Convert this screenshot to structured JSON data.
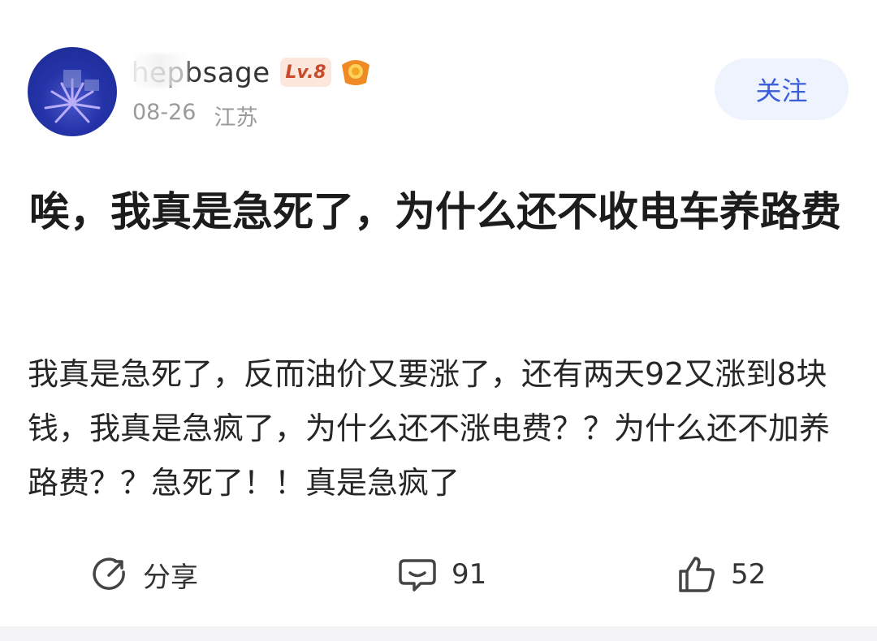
{
  "author": {
    "name": "hepbsage",
    "level_badge": "Lv.8",
    "post_date": "08-26",
    "location": "江苏",
    "follow_label": "关注"
  },
  "post": {
    "title": "唉，我真是急死了，为什么还不收电车养路费",
    "body": "我真是急死了，反而油价又要涨了，还有两天92又涨到8块钱，我真是急疯了，为什么还不涨电费？？为什么还不加养路费？？急死了！！真是急疯了"
  },
  "actions": {
    "share_label": "分享",
    "comment_count": "91",
    "like_count": "52"
  },
  "colors": {
    "accent": "#3b5fd9",
    "follow_bg": "#eef3fd",
    "badge_bg": "#fde6dc",
    "badge_text": "#c84a2d"
  }
}
